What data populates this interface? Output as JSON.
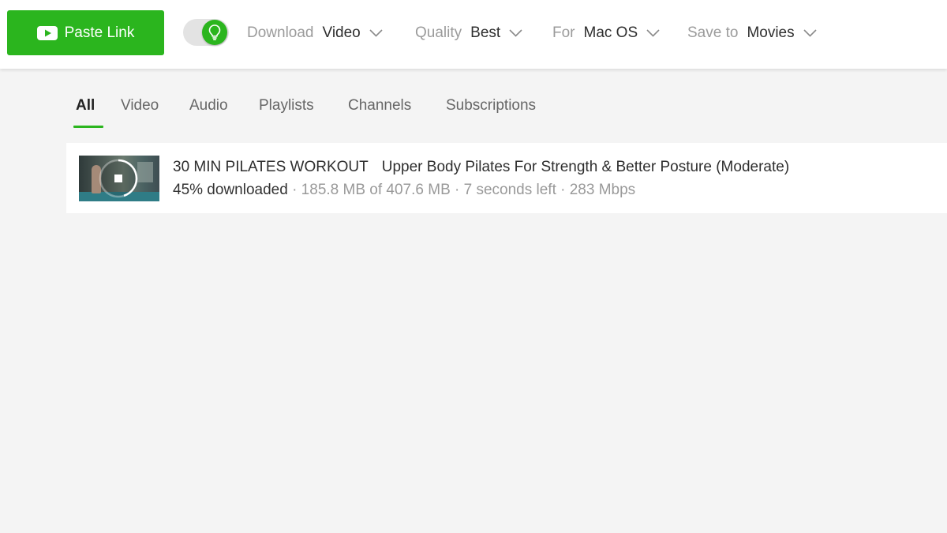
{
  "toolbar": {
    "paste_link_label": "Paste Link",
    "smart_mode_toggle": {
      "on": true,
      "icon": "lightbulb-icon"
    },
    "download": {
      "label": "Download",
      "value": "Video"
    },
    "quality": {
      "label": "Quality",
      "value": "Best"
    },
    "platform": {
      "label": "For",
      "value": "Mac OS"
    },
    "save_to": {
      "label": "Save to",
      "value": "Movies"
    }
  },
  "tabs": [
    {
      "label": "All",
      "active": true
    },
    {
      "label": "Video",
      "active": false
    },
    {
      "label": "Audio",
      "active": false
    },
    {
      "label": "Playlists",
      "active": false
    },
    {
      "label": "Channels",
      "active": false
    },
    {
      "label": "Subscriptions",
      "active": false
    }
  ],
  "downloads": [
    {
      "title_part1": "30 MIN PILATES WORKOUT",
      "title_part2": "Upper Body Pilates For Strength & Better Posture (Moderate)",
      "progress_percent": 45,
      "progress_text": "45% downloaded",
      "details": "· 185.8 MB of 407.6 MB · 7 seconds left · 283 Mbps",
      "thumbnail_icon": "stop-icon"
    }
  ],
  "colors": {
    "accent": "#2bb51e",
    "background": "#f4f4f4",
    "toolbar": "#ffffff"
  }
}
